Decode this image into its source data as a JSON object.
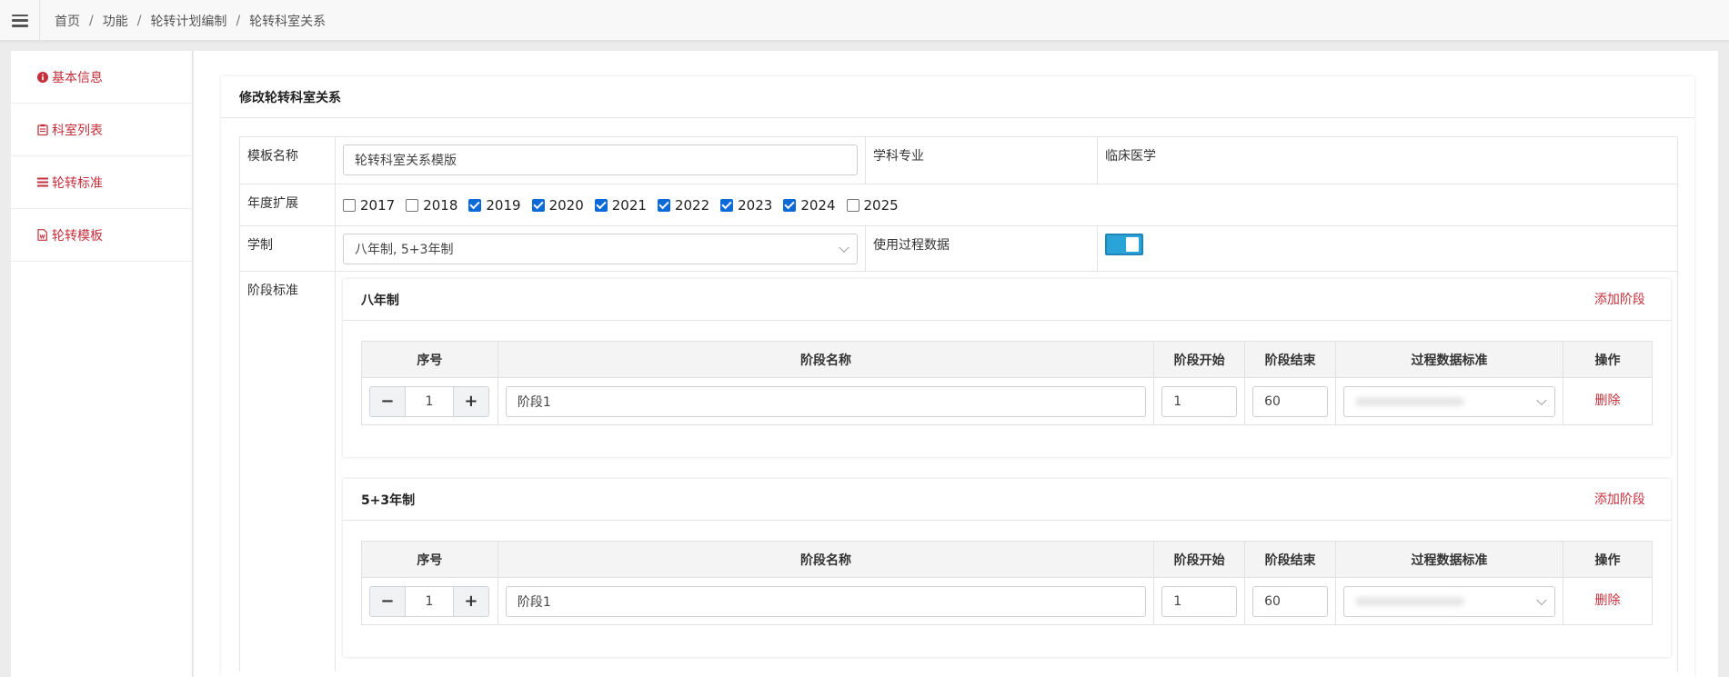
{
  "breadcrumb": [
    "首页",
    "功能",
    "轮转计划编制",
    "轮转科室关系"
  ],
  "breadcrumb_sep": "/",
  "sidebar": {
    "items": [
      {
        "label": "基本信息",
        "icon": "info-icon"
      },
      {
        "label": "科室列表",
        "icon": "clipboard-icon"
      },
      {
        "label": "轮转标准",
        "icon": "list-icon"
      },
      {
        "label": "轮转模板",
        "icon": "document-icon"
      }
    ]
  },
  "panel": {
    "title": "修改轮转科室关系",
    "template_label": "模板名称",
    "template_value": "轮转科室关系模版",
    "discipline_label": "学科专业",
    "discipline_value": "临床医学",
    "years_label": "年度扩展",
    "years": [
      {
        "year": "2017",
        "checked": false
      },
      {
        "year": "2018",
        "checked": false
      },
      {
        "year": "2019",
        "checked": true
      },
      {
        "year": "2020",
        "checked": true
      },
      {
        "year": "2021",
        "checked": true
      },
      {
        "year": "2022",
        "checked": true
      },
      {
        "year": "2023",
        "checked": true
      },
      {
        "year": "2024",
        "checked": true
      },
      {
        "year": "2025",
        "checked": false
      }
    ],
    "system_label": "学制",
    "system_value": "八年制, 5+3年制",
    "process_label": "使用过程数据",
    "process_enabled": true,
    "stage_label": "阶段标准"
  },
  "stages": [
    {
      "title": "八年制",
      "add_label": "添加阶段",
      "columns": [
        "序号",
        "阶段名称",
        "阶段开始",
        "阶段结束",
        "过程数据标准",
        "操作"
      ],
      "rows": [
        {
          "seq": "1",
          "name": "阶段1",
          "start": "1",
          "end": "60",
          "delete": "删除"
        }
      ]
    },
    {
      "title": "5+3年制",
      "add_label": "添加阶段",
      "columns": [
        "序号",
        "阶段名称",
        "阶段开始",
        "阶段结束",
        "过程数据标准",
        "操作"
      ],
      "rows": [
        {
          "seq": "1",
          "name": "阶段1",
          "start": "1",
          "end": "60",
          "delete": "删除"
        }
      ]
    }
  ],
  "stepper": {
    "minus": "−",
    "plus": "+"
  },
  "colors": {
    "accent": "#c4303c",
    "toggle": "#29a3d8",
    "checkbox": "#0b6ad8"
  }
}
